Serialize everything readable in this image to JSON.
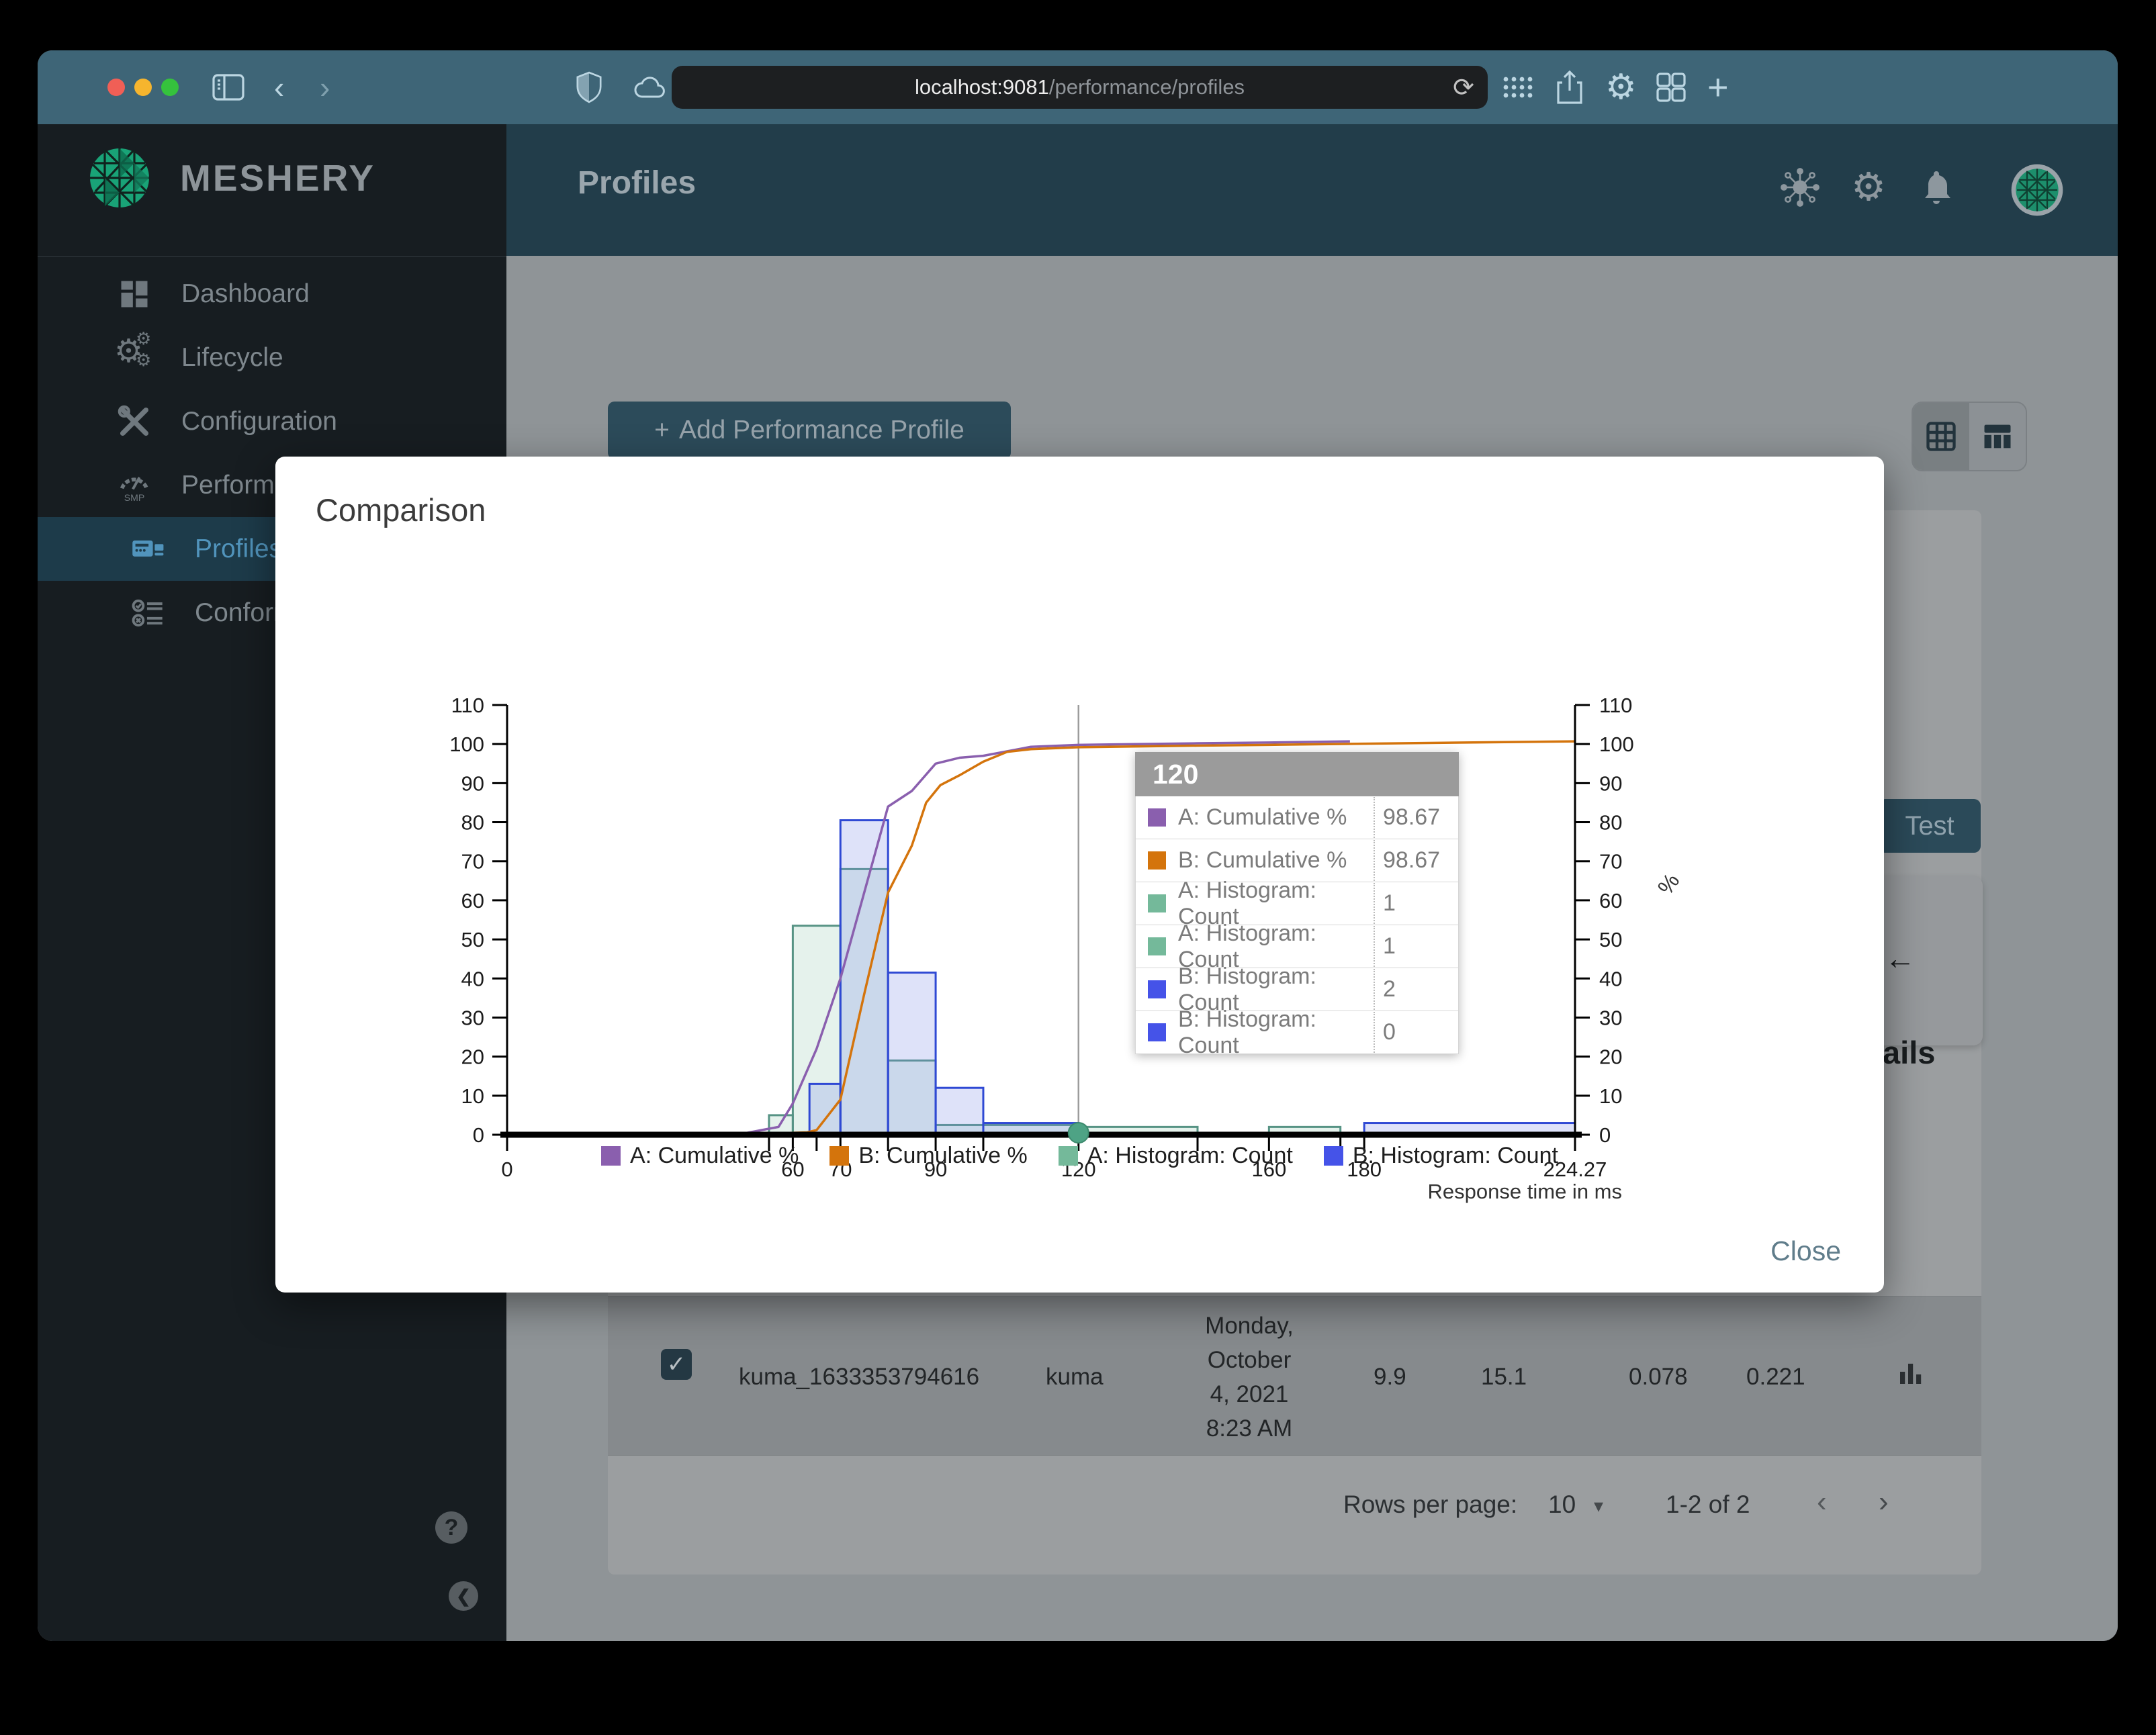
{
  "browser": {
    "url_host": "localhost:9081",
    "url_path": "/performance/profiles"
  },
  "icons": {
    "plus": "+",
    "check": "✓",
    "caret": "▾",
    "chev_left": "‹",
    "chev_right": "›",
    "refresh": "⟳",
    "gear": "⚙",
    "arrow_left": "←",
    "question": "?",
    "collapse": "❮",
    "smp": "SMP"
  },
  "sidebar": {
    "brand": "MESHERY",
    "items": [
      {
        "label": "Dashboard"
      },
      {
        "label": "Lifecycle"
      },
      {
        "label": "Configuration"
      },
      {
        "label": "Performance"
      },
      {
        "label": "Profiles"
      },
      {
        "label": "Conformance"
      }
    ]
  },
  "appbar": {
    "title": "Profiles"
  },
  "content": {
    "add_button": "Add Performance Profile",
    "test_button": "Test",
    "details_partial": "ails"
  },
  "table": {
    "row": {
      "name": "kuma_1633353794616",
      "mesh": "kuma",
      "date_lines": [
        "Monday,",
        "October",
        "4, 2021",
        "8:23 AM"
      ],
      "qps": "9.9",
      "duration": "15.1",
      "p50": "0.078",
      "p99": "0.221"
    }
  },
  "pagination": {
    "rows_per_page_label": "Rows per page:",
    "rows_per_page": "10",
    "range": "1-2 of 2"
  },
  "modal": {
    "title": "Comparison",
    "close": "Close"
  },
  "tooltip": {
    "header": "120",
    "rows": [
      {
        "swatch": "#8a5fae",
        "label": "A: Cumulative %",
        "value": "98.67"
      },
      {
        "swatch": "#d4740c",
        "label": "B: Cumulative %",
        "value": "98.67"
      },
      {
        "swatch": "#74b99a",
        "label": "A: Histogram: Count",
        "value": "1"
      },
      {
        "swatch": "#74b99a",
        "label": "A: Histogram: Count",
        "value": "1"
      },
      {
        "swatch": "#4553e8",
        "label": "B: Histogram: Count",
        "value": "2"
      },
      {
        "swatch": "#4553e8",
        "label": "B: Histogram: Count",
        "value": "0"
      }
    ]
  },
  "chart_data": {
    "type": "histogram+cumulative-line",
    "title": "Comparison",
    "xlabel": "Response time in ms",
    "right_axis_label": "%",
    "xlim": [
      0,
      224.27
    ],
    "ylim": [
      0,
      110
    ],
    "y_tick_step": 10,
    "x_major_ticks": [
      0,
      60,
      70,
      90,
      120,
      160,
      180,
      224.27
    ],
    "x_minor_ticks": [
      55,
      65,
      80,
      100,
      145,
      175
    ],
    "crosshair_x": 120,
    "selected_point": {
      "x": 120,
      "y": 0.5,
      "color": "#4ea385"
    },
    "legend_position": "bottom",
    "series": [
      {
        "name": "A: Cumulative %",
        "type": "line",
        "color": "#8a5fae",
        "legend_color": "#8a5fae",
        "points": [
          [
            0,
            0.2
          ],
          [
            50,
            0.4
          ],
          [
            57,
            2
          ],
          [
            60,
            8
          ],
          [
            65,
            22
          ],
          [
            70,
            40
          ],
          [
            75,
            62
          ],
          [
            80,
            84
          ],
          [
            85,
            88
          ],
          [
            90,
            95
          ],
          [
            95,
            96.5
          ],
          [
            100,
            97
          ],
          [
            110,
            99.3
          ],
          [
            120,
            99.8
          ],
          [
            145,
            100.2
          ],
          [
            160,
            100.4
          ],
          [
            177,
            100.7
          ]
        ]
      },
      {
        "name": "B: Cumulative %",
        "type": "line",
        "color": "#d4740c",
        "legend_color": "#d4740c",
        "points": [
          [
            0,
            0.2
          ],
          [
            55,
            0.3
          ],
          [
            63,
            0.6
          ],
          [
            65,
            1.2
          ],
          [
            70,
            9
          ],
          [
            75,
            36
          ],
          [
            80,
            62
          ],
          [
            85,
            74
          ],
          [
            88,
            85
          ],
          [
            91,
            89.5
          ],
          [
            95,
            92
          ],
          [
            100,
            95.5
          ],
          [
            105,
            98
          ],
          [
            110,
            98.7
          ],
          [
            120,
            99.2
          ],
          [
            145,
            99.6
          ],
          [
            160,
            99.8
          ],
          [
            180,
            100.1
          ],
          [
            224.27,
            100.7
          ]
        ]
      },
      {
        "name": "A: Histogram: Count",
        "type": "histogram",
        "color": "#569384",
        "legend_color": "#74b99a",
        "fill": "#89c5aa",
        "fill_opacity": 0.22,
        "buckets": [
          [
            55,
            60,
            5
          ],
          [
            60,
            70,
            53.5
          ],
          [
            70,
            80,
            68
          ],
          [
            80,
            90,
            19
          ],
          [
            90,
            120,
            2.5
          ],
          [
            120,
            145,
            2
          ],
          [
            160,
            175,
            2
          ]
        ]
      },
      {
        "name": "B: Histogram: Count",
        "type": "histogram",
        "color": "#2f49d4",
        "legend_color": "#4553e8",
        "fill": "#7a8ce8",
        "fill_opacity": 0.25,
        "buckets": [
          [
            63.5,
            70,
            13
          ],
          [
            70,
            80,
            80.5
          ],
          [
            80,
            90,
            41.5
          ],
          [
            90,
            100,
            12
          ],
          [
            100,
            120,
            3
          ],
          [
            180,
            224.27,
            3
          ]
        ]
      }
    ]
  }
}
